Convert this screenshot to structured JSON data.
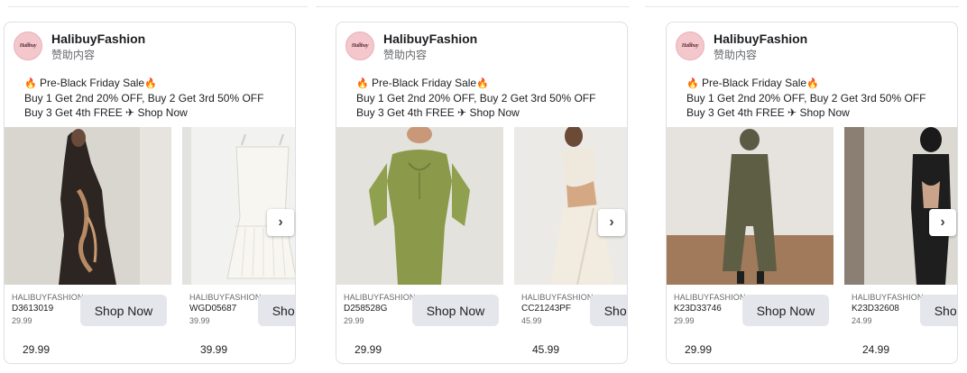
{
  "ads": [
    {
      "page_name": "HalibuyFashion",
      "sponsored": "赞助内容",
      "avatar_logo": "Halibuy",
      "body": {
        "line1_text": "Pre-Black Friday Sale",
        "line2": "Buy 1 Get 2nd 20% OFF, Buy 2 Get 3rd 50% OFF",
        "line3": "Buy 3 Get 4th FREE ✈ Shop Now"
      },
      "products": [
        {
          "shop": "HALIBUYFASHION",
          "sku": "D3613019",
          "sub_price": "29.99",
          "cta": "Shop Now",
          "price": "29.99"
        },
        {
          "shop": "HALIBUYFASHION",
          "sku": "WGD05687",
          "sub_price": "39.99",
          "cta": "Shop Now",
          "price": "39.99"
        }
      ]
    },
    {
      "page_name": "HalibuyFashion",
      "sponsored": "赞助内容",
      "avatar_logo": "Halibuy",
      "body": {
        "line1_text": "Pre-Black Friday Sale",
        "line2": "Buy 1 Get 2nd 20% OFF, Buy 2 Get 3rd 50% OFF",
        "line3": "Buy 3 Get 4th FREE ✈ Shop Now"
      },
      "products": [
        {
          "shop": "HALIBUYFASHION",
          "sku": "D258528G",
          "sub_price": "29.99",
          "cta": "Shop Now",
          "price": "29.99"
        },
        {
          "shop": "HALIBUYFASHION",
          "sku": "CC21243PF",
          "sub_price": "45.99",
          "cta": "Shop Now",
          "price": "45.99"
        }
      ]
    },
    {
      "page_name": "HalibuyFashion",
      "sponsored": "赞助内容",
      "avatar_logo": "Halibuy",
      "body": {
        "line1_text": "Pre-Black Friday Sale",
        "line2": "Buy 1 Get 2nd 20% OFF, Buy 2 Get 3rd 50% OFF",
        "line3": "Buy 3 Get 4th FREE ✈ Shop Now"
      },
      "products": [
        {
          "shop": "HALIBUYFASHION",
          "sku": "K23D33746",
          "sub_price": "29.99",
          "cta": "Shop Now",
          "price": "29.99"
        },
        {
          "shop": "HALIBUYFASHION",
          "sku": "K23D32608",
          "sub_price": "24.99",
          "cta": "Shop Now",
          "price": "24.99"
        }
      ]
    }
  ],
  "icons": {
    "fire": "fire-icon",
    "next": "chevron-right-icon"
  },
  "colors": {
    "card_border": "#dddfe2",
    "cta_bg": "#e4e6eb",
    "fire": "#f26b1d",
    "secondary_text": "#65676b"
  }
}
